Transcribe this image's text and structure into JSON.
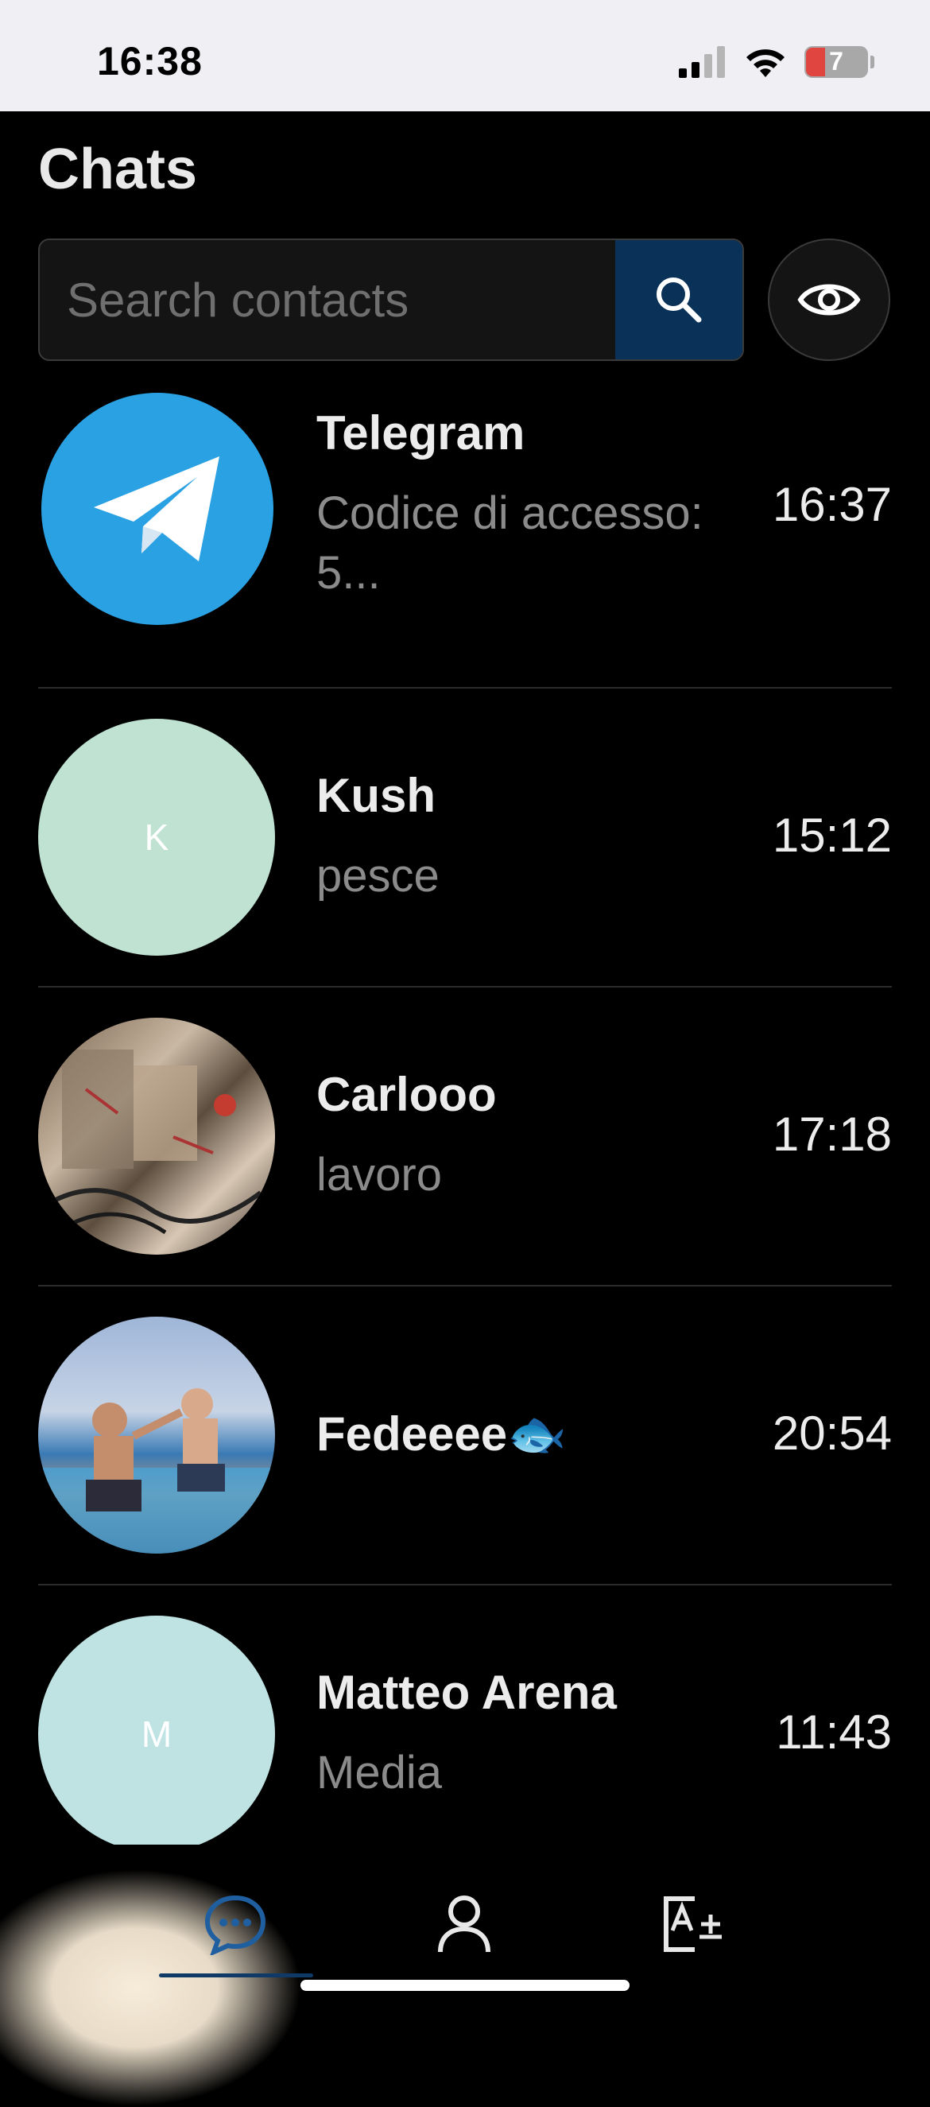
{
  "status": {
    "time": "16:38",
    "battery": "7"
  },
  "header": {
    "title": "Chats"
  },
  "search": {
    "placeholder": "Search contacts"
  },
  "chats": [
    {
      "name": "Telegram",
      "preview": "Codice di accesso: 5...",
      "time": "16:37",
      "avatar_color": "#2aa1e3",
      "icon": "telegram-logo-icon"
    },
    {
      "name": "Kush",
      "preview": "pesce",
      "time": "15:12",
      "avatar_initial": "K",
      "avatar_color": "#bfe2d2"
    },
    {
      "name": "Carlooo",
      "preview": "lavoro",
      "time": "17:18",
      "avatar_photo": "graffiti-room"
    },
    {
      "name": "Fedeeee🐟",
      "preview": "",
      "time": "20:54",
      "avatar_photo": "pool-friends"
    },
    {
      "name": "Matteo Arena",
      "preview": "Media",
      "time": "11:43",
      "avatar_initial": "M",
      "avatar_color": "#bfe3e3"
    }
  ],
  "nav": {
    "tabs": [
      "chats-icon",
      "contacts-icon",
      "translate-icon"
    ],
    "active_tab": "chats-icon"
  },
  "colors": {
    "accent": "#0a3158",
    "background": "#000000",
    "telegram_blue": "#2aa1e3"
  }
}
